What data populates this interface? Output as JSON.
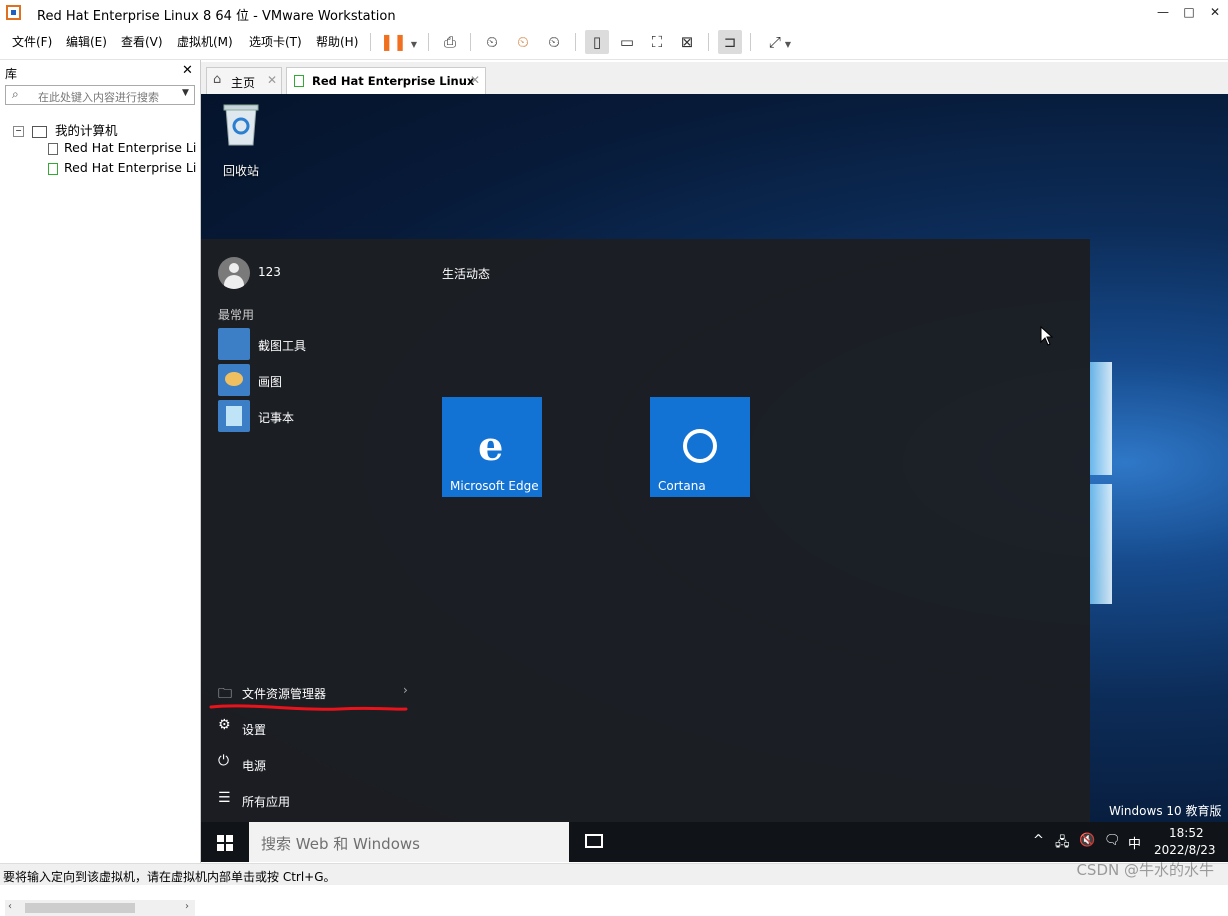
{
  "window": {
    "title": "Red Hat Enterprise Linux 8 64 位 - VMware Workstation",
    "min": "—",
    "max": "□",
    "close": "✕"
  },
  "menu": [
    "文件(F)",
    "编辑(E)",
    "查看(V)",
    "虚拟机(M)",
    "选项卡(T)",
    "帮助(H)"
  ],
  "library": {
    "header": "库",
    "close": "✕",
    "search_placeholder": "在此处键入内容进行搜索",
    "root": "我的计算机",
    "items": [
      "Red Hat Enterprise Linux",
      "Red Hat Enterprise Linux"
    ]
  },
  "tabs": [
    {
      "label": "主页",
      "close": "✕"
    },
    {
      "label": "Red Hat Enterprise Linux ...",
      "close": "✕"
    }
  ],
  "desktop": {
    "recycle_bin": "回收站"
  },
  "start_menu": {
    "user": "123",
    "most_used_header": "最常用",
    "apps": [
      "截图工具",
      "画图",
      "记事本"
    ],
    "live_header": "生活动态",
    "tiles": [
      "Microsoft Edge",
      "Cortana"
    ],
    "bottom": [
      "文件资源管理器",
      "设置",
      "电源",
      "所有应用"
    ]
  },
  "taskbar": {
    "search_placeholder": "搜索 Web 和 Windows",
    "ime": "中",
    "time": "18:52",
    "date": "2022/8/23"
  },
  "watermark": "Windows 10 教育版",
  "status": "要将输入定向到该虚拟机，请在虚拟机内部单击或按 Ctrl+G。",
  "overlay_watermark": "CSDN @牛水的水牛",
  "colors": {
    "tile_blue": "#1373d5",
    "pause_orange": "#f07020",
    "annotation_red": "#e8131b"
  }
}
